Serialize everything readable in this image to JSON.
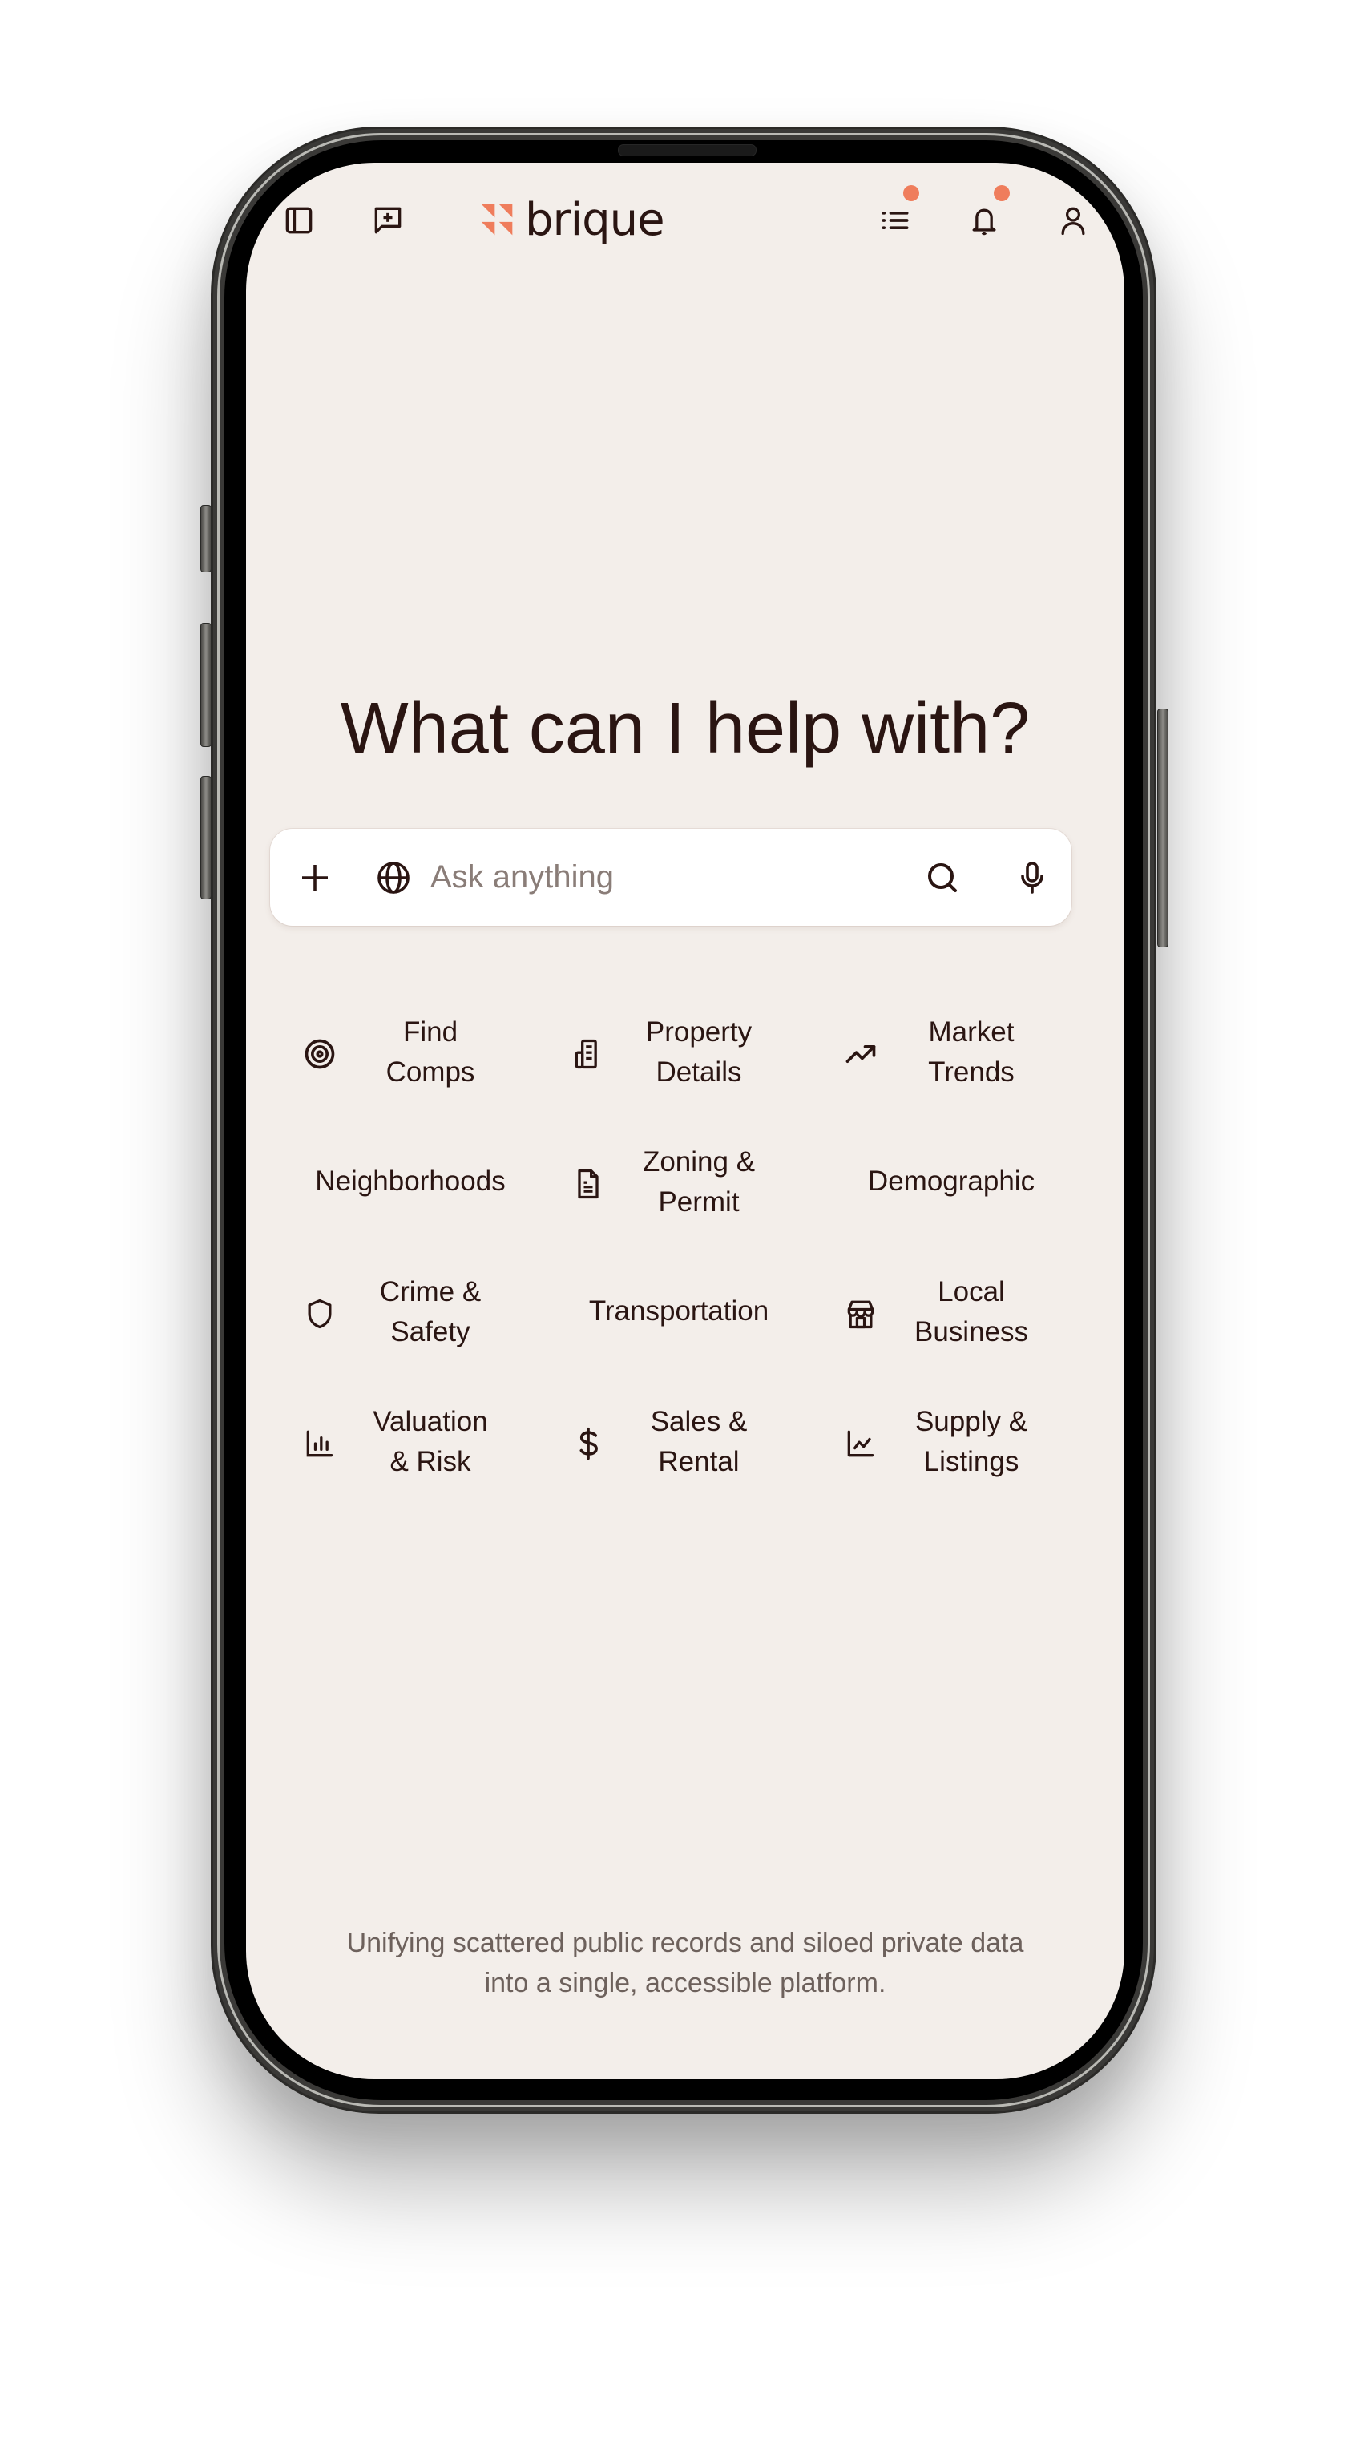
{
  "app": {
    "brand": "brique",
    "colors": {
      "accent": "#ef7d5c",
      "ink": "#2a1512",
      "muted": "#6d615c",
      "background": "#f3eeea",
      "search_bg": "#ffffff"
    }
  },
  "header": {
    "left_icons": [
      {
        "name": "sidebar-toggle-icon"
      },
      {
        "name": "new-chat-icon"
      }
    ],
    "right_icons": [
      {
        "name": "list-icon",
        "has_badge": true
      },
      {
        "name": "bell-icon",
        "has_badge": true
      },
      {
        "name": "user-icon",
        "has_badge": false
      }
    ]
  },
  "main": {
    "heading": "What can I help with?",
    "search": {
      "placeholder": "Ask anything",
      "value": "",
      "icons": [
        "plus-icon",
        "globe-icon",
        "search-icon",
        "microphone-icon"
      ]
    },
    "suggestions": [
      {
        "label": "Find\nComps",
        "icon": "target-icon"
      },
      {
        "label": "Property\nDetails",
        "icon": "building-icon"
      },
      {
        "label": "Market\nTrends",
        "icon": "trending-up-icon"
      },
      {
        "label": "Neighborhoods",
        "icon": null
      },
      {
        "label": "Zoning &\nPermit",
        "icon": "document-icon"
      },
      {
        "label": "Demographic",
        "icon": null
      },
      {
        "label": "Crime &\nSafety",
        "icon": "shield-icon"
      },
      {
        "label": "Transportation",
        "icon": null
      },
      {
        "label": "Local\nBusiness",
        "icon": "store-icon"
      },
      {
        "label": "Valuation\n& Risk",
        "icon": "bar-chart-icon"
      },
      {
        "label": "Sales &\nRental",
        "icon": "dollar-icon"
      },
      {
        "label": "Supply &\nListings",
        "icon": "line-chart-icon"
      }
    ]
  },
  "footer": {
    "tagline": "Unifying scattered public records and siloed private data\ninto a single, accessible platform."
  }
}
